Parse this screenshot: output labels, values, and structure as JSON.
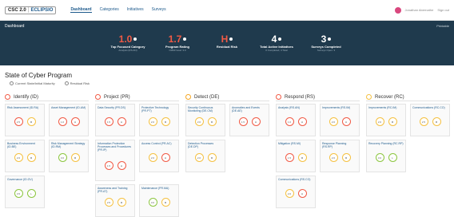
{
  "header": {
    "logo_a": "CSC 2.0",
    "logo_b": "│",
    "logo_c": "ECLIPSIO",
    "nav": [
      {
        "label": "Dashboard",
        "active": true
      },
      {
        "label": "Categories",
        "active": false
      },
      {
        "label": "Initiatives",
        "active": false
      },
      {
        "label": "Surveys",
        "active": false
      }
    ],
    "user_name": "Jonathan Abernathe",
    "signout": "Sign out"
  },
  "hero": {
    "title": "Dashboard",
    "right": "Printable",
    "stats": [
      {
        "value": "1.0",
        "label": "Top Focused Category",
        "sub": "Analysis (RS.AN)",
        "color": "#f15a45"
      },
      {
        "value": "1.7",
        "label": "Program Rating",
        "sub": "CMMI Goal: 3.0",
        "color": "#f15a45"
      },
      {
        "value": "H",
        "label": "Residual Risk",
        "sub": "",
        "color": "#f15a45"
      },
      {
        "value": "4",
        "label": "Total Active Initiatives",
        "sub": "0 Completed, 4 Total",
        "color": "#ffffff"
      },
      {
        "value": "3",
        "label": "Surveys Completed",
        "sub": "Surveys Open: 3",
        "color": "#ffffff"
      }
    ]
  },
  "program": {
    "title": "State of Cyber Program",
    "legend": [
      "Current State/Initial Maturity",
      "Residual Risk"
    ]
  },
  "columns": [
    {
      "name": "Identify (ID)",
      "color": "#f15a45",
      "cards": [
        {
          "name": "Risk Assessment (ID.RA)",
          "a": "2.5",
          "b": "M",
          "ca": "#f15a45",
          "cb": "#f5c142"
        },
        {
          "name": "Asset Management (ID.AM)",
          "a": "1.0",
          "b": "H",
          "ca": "#f15a45",
          "cb": "#f15a45"
        },
        {
          "name": "Business Environment (ID.BE)",
          "a": "2.0",
          "b": "M",
          "ca": "#f5c142",
          "cb": "#f5c142"
        },
        {
          "name": "Risk Management Strategy (ID.RM)",
          "a": "3.0",
          "b": "M",
          "ca": "#8cc63f",
          "cb": "#f5c142"
        },
        {
          "name": "Governance (ID.GV)",
          "a": "3.5",
          "b": "L",
          "ca": "#8cc63f",
          "cb": "#8cc63f"
        }
      ]
    },
    {
      "name": "Project (PR)",
      "color": "#f15a45",
      "cards": [
        {
          "name": "Data Security (PR.DS)",
          "a": "1.5",
          "b": "H",
          "ca": "#f15a45",
          "cb": "#f15a45"
        },
        {
          "name": "Protective Technology (PR.PT)",
          "a": "2.0",
          "b": "M",
          "ca": "#f5c142",
          "cb": "#f5c142"
        },
        {
          "name": "Information Protection Processes and Procedures (PR.IP)",
          "a": "1.5",
          "b": "H",
          "ca": "#f15a45",
          "cb": "#f15a45"
        },
        {
          "name": "Access Control (PR.AC)",
          "a": "2.0",
          "b": "H",
          "ca": "#f5c142",
          "cb": "#f15a45"
        },
        {
          "name": "Awareness and Training (PR.AT)",
          "a": "2.5",
          "b": "M",
          "ca": "#f5c142",
          "cb": "#f5c142"
        },
        {
          "name": "Maintenance (PR.MA)",
          "a": "3.0",
          "b": "M",
          "ca": "#8cc63f",
          "cb": "#f5c142"
        }
      ]
    },
    {
      "name": "Detect (DE)",
      "color": "#f5a623",
      "cards": [
        {
          "name": "Security Continuous Monitoring (DE.CM)",
          "a": "2.0",
          "b": "M",
          "ca": "#f5c142",
          "cb": "#f5c142"
        },
        {
          "name": "Anomalies and Events (DE.AE)",
          "a": "1.5",
          "b": "H",
          "ca": "#f15a45",
          "cb": "#f15a45"
        },
        {
          "name": "Detection Processes (DE.DP)",
          "a": "2.0",
          "b": "M",
          "ca": "#f5c142",
          "cb": "#f5c142"
        }
      ]
    },
    {
      "name": "Respond (RS)",
      "color": "#f15a45",
      "cards": [
        {
          "name": "Analysis (RS.AN)",
          "a": "1.0",
          "b": "H",
          "ca": "#f15a45",
          "cb": "#f15a45"
        },
        {
          "name": "Improvements (RS.IM)",
          "a": "2.0",
          "b": "H",
          "ca": "#f5c142",
          "cb": "#f15a45"
        },
        {
          "name": "Mitigation (RS.MI)",
          "a": "1.5",
          "b": "M",
          "ca": "#f15a45",
          "cb": "#f5c142"
        },
        {
          "name": "Response Planning (RS.RP)",
          "a": "2.0",
          "b": "M",
          "ca": "#f5c142",
          "cb": "#f5c142"
        },
        {
          "name": "Communications (RS.CO)",
          "a": "2.0",
          "b": "H",
          "ca": "#f5c142",
          "cb": "#f15a45"
        }
      ]
    },
    {
      "name": "Recover (RC)",
      "color": "#f5c142",
      "cards": [
        {
          "name": "Improvements (RC.IM)",
          "a": "2.0",
          "b": "M",
          "ca": "#f5c142",
          "cb": "#f5c142"
        },
        {
          "name": "Communications (RC.CO)",
          "a": "2.5",
          "b": "M",
          "ca": "#f5c142",
          "cb": "#f5c142"
        },
        {
          "name": "Recovery Planning (RC.RP)",
          "a": "3.0",
          "b": "L",
          "ca": "#8cc63f",
          "cb": "#8cc63f"
        }
      ]
    }
  ]
}
